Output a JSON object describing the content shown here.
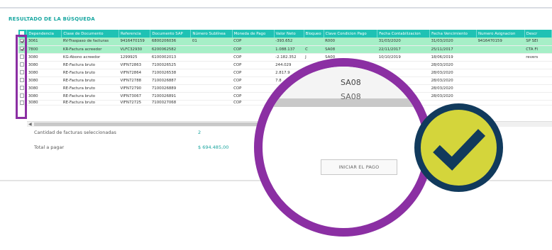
{
  "title": "RESULTADO DE LA BÚSQUEDA",
  "columns": [
    "Dependencia",
    "Clase de Documento",
    "Referencia",
    "Documento SAP",
    "Número Sublínea",
    "Moneda de Pago",
    "Valor Neto",
    "Bloqueo",
    "Clave Condicion Pago",
    "Fecha Contabilizacion",
    "Fecha Vencimiento",
    "Numero Asignacion",
    "Descr"
  ],
  "rows": [
    {
      "checked": true,
      "cells": [
        "3061",
        "RV-Traspaso de facturas",
        "9416470159",
        "6800206036",
        "01",
        "COP",
        "-393.652",
        "",
        "R000",
        "31/03/2020",
        "31/03/2020",
        "9416470159",
        "SP SEI"
      ]
    },
    {
      "checked": true,
      "cells": [
        "7800",
        "KR-Factura acreedor",
        "VLFC32930",
        "6200062582",
        "",
        "COP",
        "1.088.137",
        "C",
        "SA08",
        "22/11/2017",
        "25/11/2017",
        "",
        "CTA FI"
      ]
    },
    {
      "checked": false,
      "cells": [
        "3080",
        "KG-Abono acreedor",
        "1299925",
        "6100002013",
        "",
        "COP",
        "-2.182.352",
        "J",
        "SA00",
        "10/10/2019",
        "18/06/2019",
        "",
        "revers"
      ]
    },
    {
      "checked": false,
      "cells": [
        "3080",
        "RE-Factura bruto",
        "VIFN72863",
        "7100026525",
        "",
        "COP",
        "244.029",
        "",
        "",
        "",
        "28/03/2020",
        "",
        ""
      ]
    },
    {
      "checked": false,
      "cells": [
        "3080",
        "RE-Factura bruto",
        "VIFN72864",
        "7100026538",
        "",
        "COP",
        "2.817.9",
        "",
        "",
        "",
        "28/03/2020",
        "",
        ""
      ]
    },
    {
      "checked": false,
      "cells": [
        "3080",
        "RE-Factura bruto",
        "VIFN72788",
        "7100026887",
        "",
        "COP",
        "7.8",
        "",
        "",
        "",
        "28/03/2020",
        "",
        ""
      ]
    },
    {
      "checked": false,
      "cells": [
        "3080",
        "RE-Factura bruto",
        "VIFN72790",
        "7100026889",
        "",
        "COP",
        "",
        "",
        "",
        "",
        "28/03/2020",
        "",
        ""
      ]
    },
    {
      "checked": false,
      "cells": [
        "3080",
        "RE-Factura bruto",
        "VIFN73067",
        "7100026891",
        "",
        "COP",
        "",
        "",
        "",
        "",
        "28/03/2020",
        "",
        ""
      ]
    },
    {
      "checked": false,
      "cells": [
        "3080",
        "RE-Factura bruto",
        "VIFN72725",
        "7100027068",
        "",
        "COP",
        "",
        "",
        "",
        "",
        "",
        "",
        ""
      ]
    }
  ],
  "summary": {
    "selected_label": "Cantidad de facturas seleccionadas",
    "selected_value": "2",
    "total_label": "Total a pagar",
    "total_value": "$ 694.485,00"
  },
  "magnifier": {
    "option_1": "SA08",
    "option_2": "SA08",
    "pay_button": "INICIAR EL PAGO"
  },
  "colors": {
    "accent": "#1fc2b4",
    "selected_row": "#a6efc7",
    "highlight": "#8b2fa3",
    "badge_fill": "#d4d53b",
    "badge_ring": "#113a5c"
  },
  "icons": [
    "check-icon"
  ]
}
